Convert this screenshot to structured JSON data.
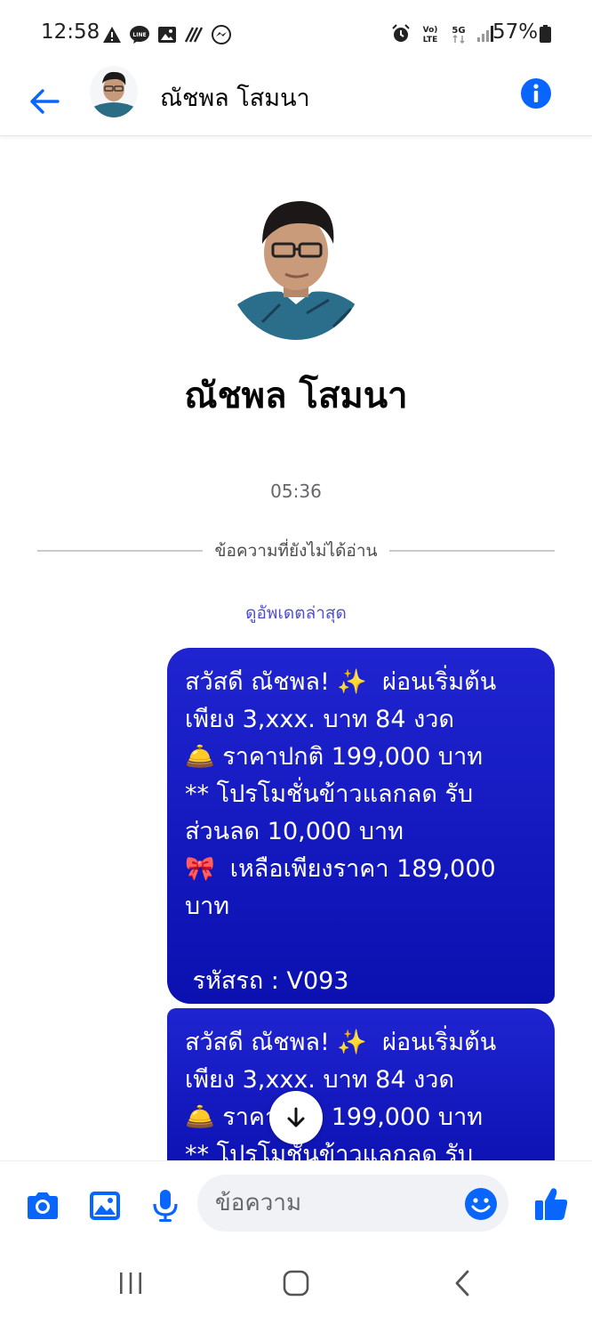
{
  "status_bar": {
    "time": "12:58",
    "battery": "57%",
    "left_icons": [
      "warning-icon",
      "line-icon",
      "image-icon",
      "no-signal-icon",
      "messenger-icon"
    ],
    "right_icons": [
      "alarm-icon",
      "volte-icon",
      "5g-icon",
      "signal-bars-icon",
      "battery-icon"
    ],
    "volte_label": "Vo) LTE",
    "net_label": "5G"
  },
  "header": {
    "contact_name": "ณัชพล โสมนา",
    "icons": {
      "back": "back-arrow-icon",
      "info": "info-icon"
    }
  },
  "profile": {
    "name": "ณัชพล โสมนา"
  },
  "conversation": {
    "timestamp": "05:36",
    "unread_divider": "ข้อความที่ยังไม่ได้อ่าน",
    "see_updates": "ดูอัพเดตล่าสุด",
    "messages": [
      {
        "text": "สวัสดี ณัชพล! ✨  ผ่อนเริ่มต้นเพียง 3,xxx. บาท 84 งวด\n🛎️ ราคาปกติ 199,000 บาท\n** โปรโมชั่นข้าวแลกลด รับส่วนลด 10,000 บาท\n🎀  เหลือเพียงราคา 189,000 บาท\n\n รหัสรถ : V093"
      },
      {
        "text": "สวัสดี ณัชพล! ✨  ผ่อนเริ่มต้นเพียง 3,xxx. บาท 84 งวด\n🛎️ ราคาปกติ 199,000 บาท\n** โปรโมชั่นข้าวแลกลด รับ"
      }
    ]
  },
  "composer": {
    "placeholder": "ข้อความ",
    "icons": [
      "camera-icon",
      "gallery-icon",
      "microphone-icon",
      "emoji-icon",
      "thumbs-up-icon"
    ]
  },
  "colors": {
    "accent": "#0866ff",
    "bubble": "#1218c4",
    "link": "#4f4fd0"
  }
}
